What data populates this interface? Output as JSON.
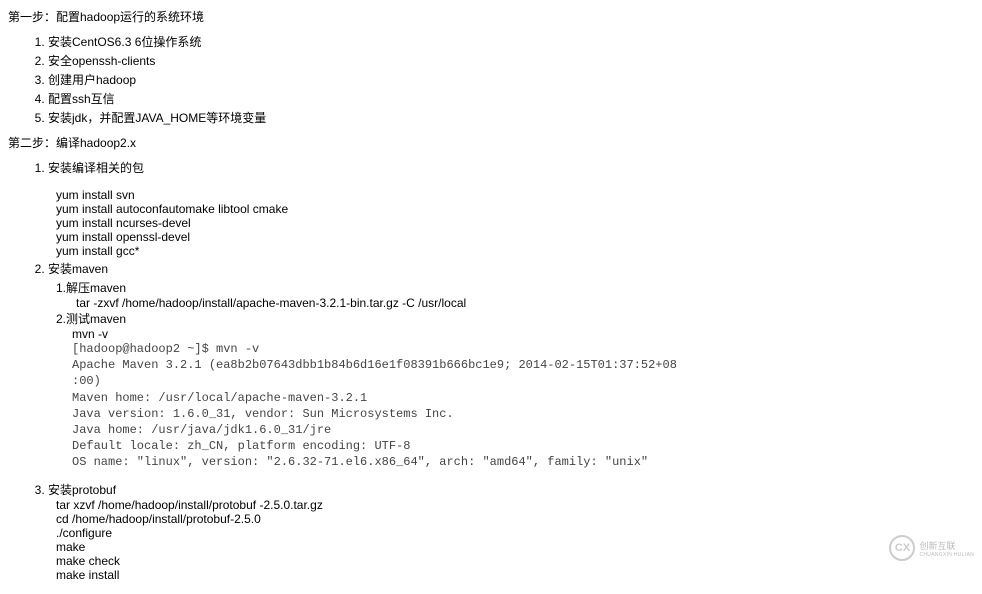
{
  "step1": {
    "title": "第一步：配置hadoop运行的系统环境",
    "items": [
      "安装CentOS6.3 6位操作系统",
      "安全openssh-clients",
      "创建用户hadoop",
      "配置ssh互信",
      "安装jdk，并配置JAVA_HOME等环境变量"
    ]
  },
  "step2": {
    "title": "第二步：编译hadoop2.x",
    "item1": {
      "label": "安装编译相关的包",
      "cmds": [
        "yum install svn",
        "yum install autoconfautomake libtool cmake",
        "yum install ncurses-devel",
        "yum install openssl-devel",
        "yum install gcc*"
      ]
    },
    "item2": {
      "label": "安装maven",
      "sub1": {
        "label": "1.解压maven",
        "cmd": "tar -zxvf /home/hadoop/install/apache-maven-3.2.1-bin.tar.gz -C /usr/local"
      },
      "sub2": {
        "label": "2.测试maven",
        "cmd": "mvn -v",
        "output": "[hadoop@hadoop2 ~]$ mvn -v\nApache Maven 3.2.1 (ea8b2b07643dbb1b84b6d16e1f08391b666bc1e9; 2014-02-15T01:37:52+08\n:00)\nMaven home: /usr/local/apache-maven-3.2.1\nJava version: 1.6.0_31, vendor: Sun Microsystems Inc.\nJava home: /usr/java/jdk1.6.0_31/jre\nDefault locale: zh_CN, platform encoding: UTF-8\nOS name: \"linux\", version: \"2.6.32-71.el6.x86_64\", arch: \"amd64\", family: \"unix\""
      }
    },
    "item3": {
      "label": "安装protobuf",
      "cmds": [
        "tar xzvf  /home/hadoop/install/protobuf -2.5.0.tar.gz",
        "cd /home/hadoop/install/protobuf-2.5.0",
        "./configure",
        "make",
        "make check",
        "make install"
      ]
    }
  },
  "logo": {
    "text": "创新互联",
    "sub": "CHUANGXIN HULIAN",
    "mark": "CX"
  }
}
